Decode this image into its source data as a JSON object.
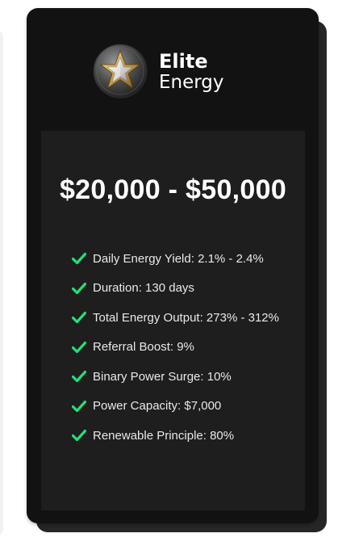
{
  "brand": {
    "line1": "Elite",
    "line2": "Energy",
    "emblem_icon": "star-emblem-icon"
  },
  "plan": {
    "price_range": "$20,000 - $50,000"
  },
  "features": [
    "Daily Energy Yield: 2.1% - 2.4%",
    "Duration: 130 days",
    "Total Energy Output: 273% - 312%",
    "Referral Boost: 9%",
    "Binary Power Surge: 10%",
    "Power Capacity: $7,000",
    "Renewable Principle: 80%"
  ],
  "colors": {
    "card_background": "#121212",
    "panel_background": "#1e1e1e",
    "check_green": "#22e07a",
    "text_white": "#ffffff"
  },
  "icons": {
    "feature_icon": "check-icon"
  }
}
